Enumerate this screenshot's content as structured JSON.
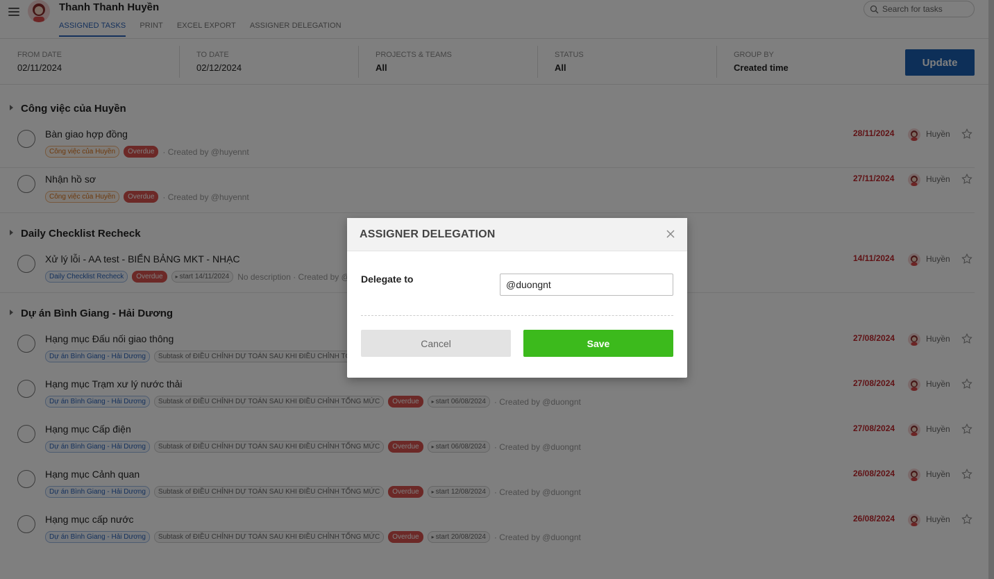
{
  "header": {
    "user_name": "Thanh Thanh Huyền",
    "tabs": [
      {
        "label": "ASSIGNED TASKS",
        "active": true
      },
      {
        "label": "PRINT"
      },
      {
        "label": "EXCEL EXPORT"
      },
      {
        "label": "ASSIGNER DELEGATION"
      }
    ],
    "search_placeholder": "Search for tasks"
  },
  "filters": {
    "from_date": {
      "label": "FROM DATE",
      "value": "02/11/2024"
    },
    "to_date": {
      "label": "TO DATE",
      "value": "02/12/2024"
    },
    "projects": {
      "label": "PROJECTS & TEAMS",
      "value": "All"
    },
    "status": {
      "label": "STATUS",
      "value": "All"
    },
    "group_by": {
      "label": "GROUP BY",
      "value": "Created time"
    },
    "update_label": "Update"
  },
  "groups": [
    {
      "name": "Công việc của Huyền",
      "tasks": [
        {
          "title": "Bàn giao hợp đồng",
          "project_tag": "Công việc của Huyền",
          "overdue": "Overdue",
          "meta": "· Created by @huyennt",
          "due": "28/11/2024",
          "assignee": "Huyền"
        },
        {
          "title": "Nhận hồ sơ",
          "project_tag": "Công việc của Huyền",
          "overdue": "Overdue",
          "meta": "· Created by @huyennt",
          "due": "27/11/2024",
          "assignee": "Huyền"
        }
      ]
    },
    {
      "name": "Daily Checklist Recheck",
      "tasks": [
        {
          "title": "Xử lý lỗi - AA test - BIỂN BẢNG MKT - NHẠC",
          "project_tag": "Daily Checklist Recheck",
          "overdue": "Overdue",
          "start": "start 14/11/2024",
          "meta": "No description · Created by @",
          "due": "14/11/2024",
          "assignee": "Huyền"
        }
      ]
    },
    {
      "name": "Dự án Bình Giang - Hải Dương",
      "tasks": [
        {
          "title": "Hạng mục Đấu nối giao thông",
          "project_tag": "Dự án Bình Giang - Hải Dương",
          "subtask": "Subtask of ĐIỀU CHỈNH DỰ TOÁN SAU KHI ĐIỀU CHỈNH TỔNG M",
          "due": "27/08/2024",
          "assignee": "Huyền"
        },
        {
          "title": "Hạng mục Trạm xư lý nước thải",
          "project_tag": "Dự án Bình Giang - Hải Dương",
          "subtask": "Subtask of ĐIỀU CHỈNH DỰ TOÁN SAU KHI ĐIỀU CHỈNH TỔNG MỨC",
          "overdue": "Overdue",
          "start": "start 06/08/2024",
          "meta": "· Created by @duongnt",
          "due": "27/08/2024",
          "assignee": "Huyền"
        },
        {
          "title": "Hạng mục Cấp điện",
          "project_tag": "Dự án Bình Giang - Hải Dương",
          "subtask": "Subtask of ĐIỀU CHỈNH DỰ TOÁN SAU KHI ĐIỀU CHỈNH TỔNG MỨC",
          "overdue": "Overdue",
          "start": "start 06/08/2024",
          "meta": "· Created by @duongnt",
          "due": "27/08/2024",
          "assignee": "Huyền"
        },
        {
          "title": "Hạng mục Cảnh quan",
          "project_tag": "Dự án Bình Giang - Hải Dương",
          "subtask": "Subtask of ĐIỀU CHỈNH DỰ TOÁN SAU KHI ĐIỀU CHỈNH TỔNG MỨC",
          "overdue": "Overdue",
          "start": "start 12/08/2024",
          "meta": "· Created by @duongnt",
          "due": "26/08/2024",
          "assignee": "Huyền"
        },
        {
          "title": "Hạng mục cấp nước",
          "project_tag": "Dự án Bình Giang - Hải Dương",
          "subtask": "Subtask of ĐIỀU CHỈNH DỰ TOÁN SAU KHI ĐIỀU CHỈNH TỔNG MỨC",
          "overdue": "Overdue",
          "start": "start 20/08/2024",
          "meta": "· Created by @duongnt",
          "due": "26/08/2024",
          "assignee": "Huyền"
        }
      ]
    }
  ],
  "modal": {
    "title": "ASSIGNER DELEGATION",
    "delegate_label": "Delegate to",
    "delegate_value": "@duongnt",
    "cancel_label": "Cancel",
    "save_label": "Save"
  },
  "icons": {
    "menu": "menu-icon",
    "search": "search-icon",
    "close": "close-icon",
    "star": "star-icon",
    "caret": "caret-right-icon"
  },
  "colors": {
    "accent_blue": "#1a5fb0",
    "save_green": "#3cba1c",
    "overdue_red": "#d9534f",
    "due_date_red": "#c1272d"
  }
}
